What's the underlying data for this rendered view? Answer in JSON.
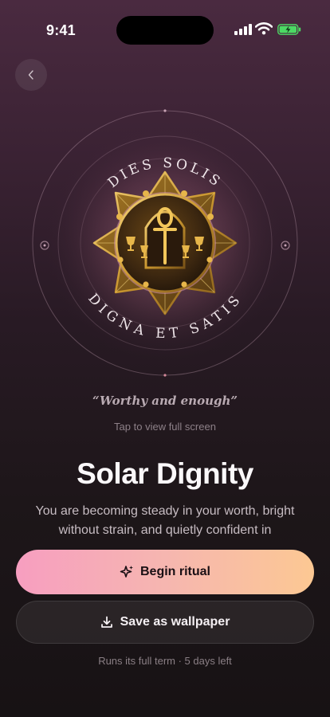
{
  "status": {
    "time": "9:41"
  },
  "amulet": {
    "arc_top": "DIES SOLIS",
    "arc_bottom": "DIGNA ET SATIS"
  },
  "motto": "“Worthy and enough”",
  "hint": "Tap to view full screen",
  "title": "Solar Dignity",
  "description": "You are becoming steady in your worth, bright without strain, and quietly confident in",
  "actions": {
    "primary_label": "Begin ritual",
    "secondary_label": "Save as wallpaper"
  },
  "footnote": "Runs its full term · 5 days left",
  "colors": {
    "gold": "#c9962f",
    "accent_gradient_start": "#f79ec0",
    "accent_gradient_end": "#fcc893",
    "battery_green": "#4cd964"
  }
}
